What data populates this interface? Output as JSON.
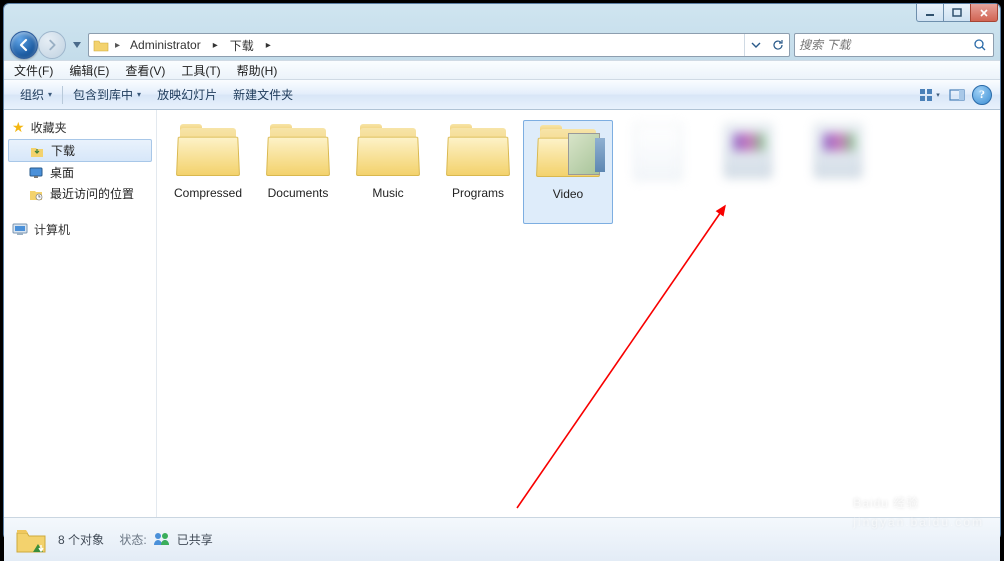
{
  "breadcrumb": {
    "segments": [
      "Administrator",
      "下载"
    ]
  },
  "search": {
    "placeholder": "搜索 下载"
  },
  "menus": {
    "file": "文件(F)",
    "edit": "编辑(E)",
    "view": "查看(V)",
    "tools": "工具(T)",
    "help": "帮助(H)"
  },
  "toolbar": {
    "organize": "组织",
    "include": "包含到库中",
    "slideshow": "放映幻灯片",
    "newfolder": "新建文件夹"
  },
  "sidebar": {
    "favorites": "收藏夹",
    "items": {
      "downloads": "下载",
      "desktop": "桌面",
      "recent": "最近访问的位置"
    },
    "computer": "计算机"
  },
  "items": [
    {
      "label": "Compressed",
      "type": "folder"
    },
    {
      "label": "Documents",
      "type": "folder"
    },
    {
      "label": "Music",
      "type": "folder"
    },
    {
      "label": "Programs",
      "type": "folder"
    },
    {
      "label": "Video",
      "type": "folder",
      "selected": true,
      "thumb": true
    },
    {
      "label": "",
      "type": "file",
      "blur": true
    },
    {
      "label": "",
      "type": "rar",
      "blur": true
    },
    {
      "label": "",
      "type": "rar",
      "blur": true
    }
  ],
  "status": {
    "count": "8 个对象",
    "state_label": "状态:",
    "state_value": "已共享"
  },
  "watermark": {
    "brand": "Baidu 经验",
    "sub": "jingyan.baidu.com"
  }
}
